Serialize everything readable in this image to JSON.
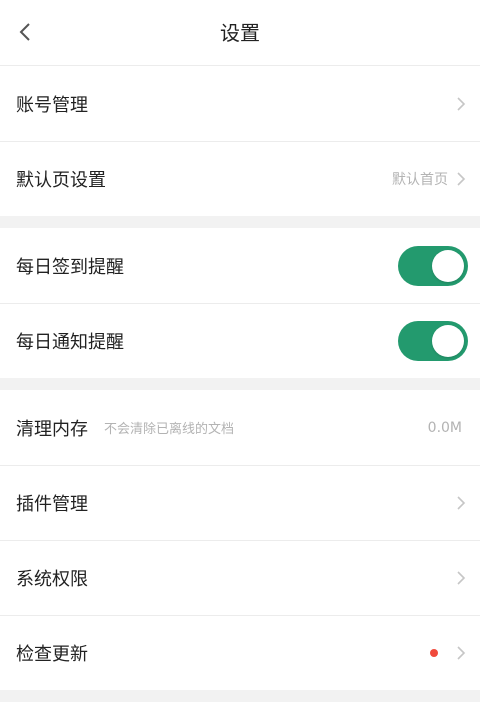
{
  "header": {
    "title": "设置",
    "back_icon": "chevron-left-icon"
  },
  "group1": [
    {
      "label": "账号管理",
      "value": ""
    },
    {
      "label": "默认页设置",
      "value": "默认首页"
    }
  ],
  "group2": [
    {
      "label": "每日签到提醒",
      "toggle": true
    },
    {
      "label": "每日通知提醒",
      "toggle": true
    }
  ],
  "group3": [
    {
      "label": "清理内存",
      "sub": "不会清除已离线的文档",
      "value": "0.0M"
    },
    {
      "label": "插件管理"
    },
    {
      "label": "系统权限"
    },
    {
      "label": "检查更新",
      "badge": "red-dot"
    }
  ],
  "colors": {
    "accent": "#239a6e",
    "badge": "#f04a3c",
    "background": "#f2f2f2"
  }
}
